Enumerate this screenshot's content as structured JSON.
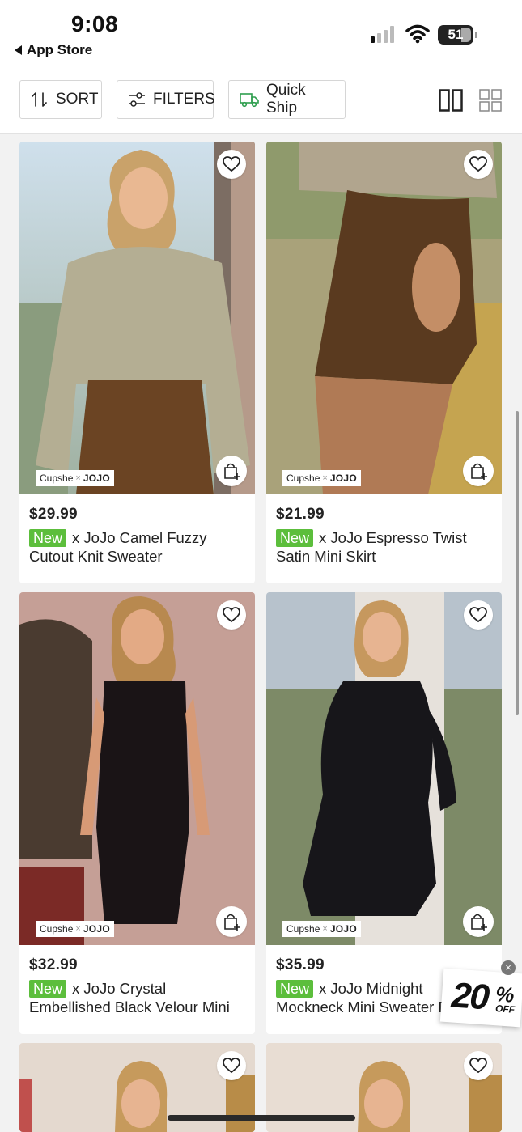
{
  "status_bar": {
    "time": "9:08",
    "back_label": "App Store",
    "battery": "51"
  },
  "toolbar": {
    "sort_label": "SORT",
    "filters_label": "FILTERS",
    "quick_ship_label": "Quick Ship",
    "colors": {
      "quick_ship_green": "#2e9e4e"
    }
  },
  "products": [
    {
      "price": "$29.99",
      "badge": "New",
      "title_line1": "x JoJo Camel Fuzzy",
      "title_line2": "Cutout Knit Sweater",
      "brand_left": "Cupshe",
      "brand_x": "×",
      "brand_right": "JOJO"
    },
    {
      "price": "$21.99",
      "badge": "New",
      "title_line1": "x JoJo Espresso Twist",
      "title_line2": "Satin Mini Skirt",
      "brand_left": "Cupshe",
      "brand_x": "×",
      "brand_right": "JOJO"
    },
    {
      "price": "$32.99",
      "badge": "New",
      "title_line1": "x JoJo Crystal",
      "title_line2": "Embellished Black Velour Mini",
      "brand_left": "Cupshe",
      "brand_x": "×",
      "brand_right": "JOJO"
    },
    {
      "price": "$35.99",
      "badge": "New",
      "title_line1": "x JoJo Midnight",
      "title_line2": "Mockneck Mini Sweater D",
      "brand_left": "Cupshe",
      "brand_x": "×",
      "brand_right": "JOJO"
    }
  ],
  "promo": {
    "number": "20",
    "percent": "%",
    "off": "OFF",
    "close": "×"
  },
  "colors": {
    "new_badge": "#5cbe3c"
  }
}
